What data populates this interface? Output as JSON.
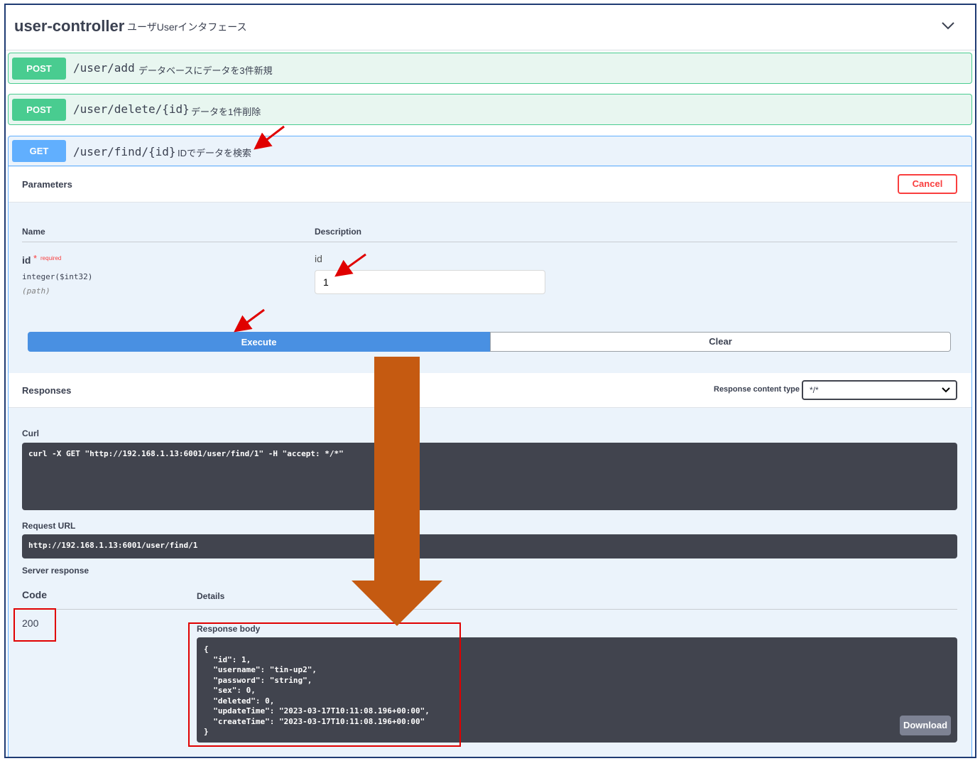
{
  "tag": {
    "title": "user-controller",
    "description": "ユーザUserインタフェース"
  },
  "operations": [
    {
      "method": "POST",
      "path": "/user/add",
      "summary": "データベースにデータを3件新規"
    },
    {
      "method": "POST",
      "path": "/user/delete/{id}",
      "summary": "データを1件削除"
    },
    {
      "method": "GET",
      "path": "/user/find/{id}",
      "summary": "IDでデータを検索"
    }
  ],
  "parameters": {
    "title": "Parameters",
    "cancel_label": "Cancel",
    "col_name": "Name",
    "col_description": "Description",
    "param": {
      "name": "id",
      "required_mark": "*",
      "required_label": "required",
      "type": "integer($int32)",
      "in": "(path)",
      "description": "id",
      "value": "1"
    },
    "execute_label": "Execute",
    "clear_label": "Clear"
  },
  "responses": {
    "title": "Responses",
    "content_type_label": "Response content type",
    "content_type_value": "*/*",
    "curl_label": "Curl",
    "curl": "curl -X GET \"http://192.168.1.13:6001/user/find/1\" -H \"accept: */*\"",
    "request_url_label": "Request URL",
    "request_url": "http://192.168.1.13:6001/user/find/1",
    "server_response_label": "Server response",
    "code_col": "Code",
    "details_col": "Details",
    "status_code": "200",
    "response_body_label": "Response body",
    "response_body": "{\n  \"id\": 1,\n  \"username\": \"tin-up2\",\n  \"password\": \"string\",\n  \"sex\": 0,\n  \"deleted\": 0,\n  \"updateTime\": \"2023-03-17T10:11:08.196+00:00\",\n  \"createTime\": \"2023-03-17T10:11:08.196+00:00\"\n}",
    "download_label": "Download"
  },
  "colors": {
    "post": "#49cc90",
    "get": "#61affe",
    "execute": "#4990e2",
    "cancel": "#f93e3e",
    "annotation_red": "#e00000",
    "annotation_arrow": "#c55a11"
  }
}
